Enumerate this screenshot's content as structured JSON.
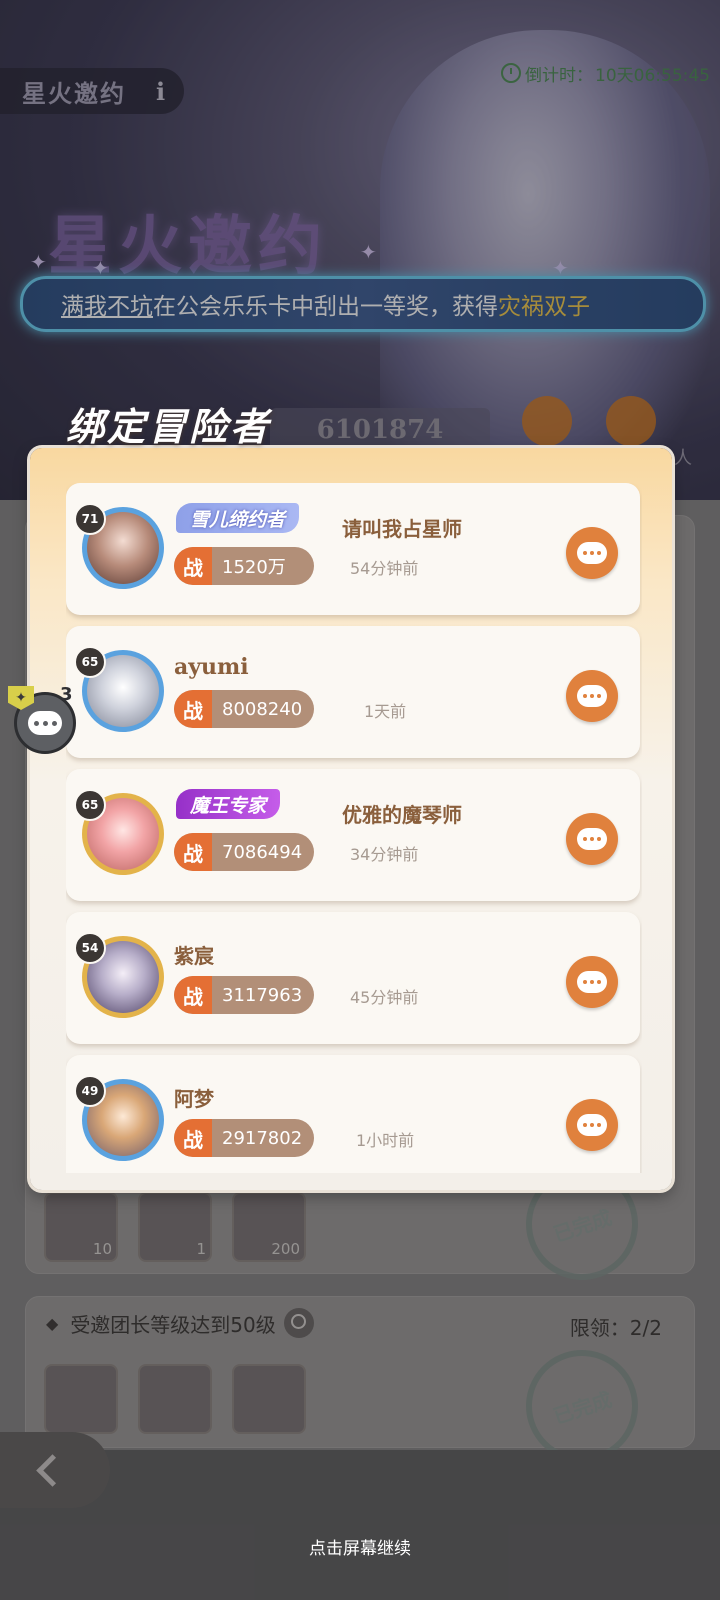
{
  "header": {
    "event_title": "星火邀约",
    "info_label": "i",
    "countdown_label": "倒计时：",
    "countdown_value": "10天06:55:45",
    "banner_title": "星火邀约"
  },
  "marquee": {
    "player": "满我不坑",
    "text_middle": "在公会乐乐卡中刮出一等奖，获得",
    "reward": "灾祸双子"
  },
  "background": {
    "uid_text": "6101874",
    "reward_counts": [
      "10",
      "1",
      "200"
    ],
    "done_stamp": "已完成",
    "task_label": "受邀团长等级达到50级",
    "task_limit": "限领：2/2",
    "side_stub": "人"
  },
  "float_chat": {
    "badge": "✦",
    "count": "3"
  },
  "modal": {
    "title": "绑定冒险者",
    "power_badge": "战",
    "players": [
      {
        "level": "71",
        "tag": "雪儿缔约者",
        "name": "请叫我占星师",
        "power": "1520万",
        "last_active": "54分钟前"
      },
      {
        "level": "65",
        "tag": "",
        "name": "ayumi",
        "power": "8008240",
        "last_active": "1天前"
      },
      {
        "level": "65",
        "tag": "魔王专家",
        "name": "优雅的魔琴师",
        "power": "7086494",
        "last_active": "34分钟前"
      },
      {
        "level": "54",
        "tag": "",
        "name": "紫宸",
        "power": "3117963",
        "last_active": "45分钟前"
      },
      {
        "level": "49",
        "tag": "",
        "name": "阿梦",
        "power": "2917802",
        "last_active": "1小时前"
      }
    ]
  },
  "footer": {
    "continue_text": "点击屏幕继续"
  },
  "colors": {
    "accent_orange": "#e0813d",
    "power_bar": "#b28f78",
    "name_brown": "#8a5f3c",
    "countdown_green": "#4a8a52",
    "marquee_border": "#6ad0f3"
  }
}
